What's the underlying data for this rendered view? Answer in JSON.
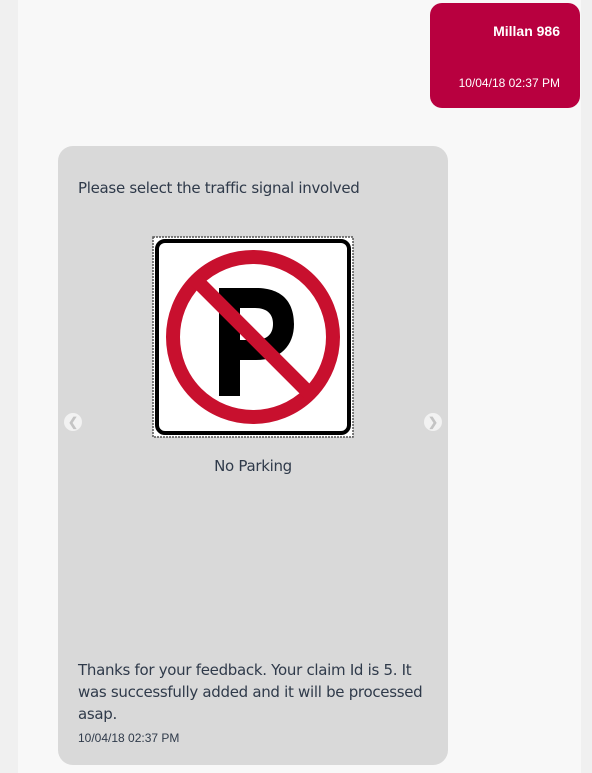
{
  "user_message": {
    "name": "Millan 986",
    "timestamp": "10/04/18 02:37 PM"
  },
  "bot_message": {
    "prompt": "Please select the traffic signal involved",
    "carousel": {
      "selected_caption": "No Parking",
      "sign_icon": "no-parking-sign",
      "prev_icon": "chevron-left-icon",
      "next_icon": "chevron-right-icon"
    },
    "confirmation": "Thanks for your feedback. Your claim Id is 5. It was successfully added and it will be processed asap.",
    "timestamp": "10/04/18 02:37 PM"
  },
  "colors": {
    "user_bubble": "#b8003f",
    "bot_bubble": "#d9d9d9",
    "sign_red": "#c8102e"
  }
}
